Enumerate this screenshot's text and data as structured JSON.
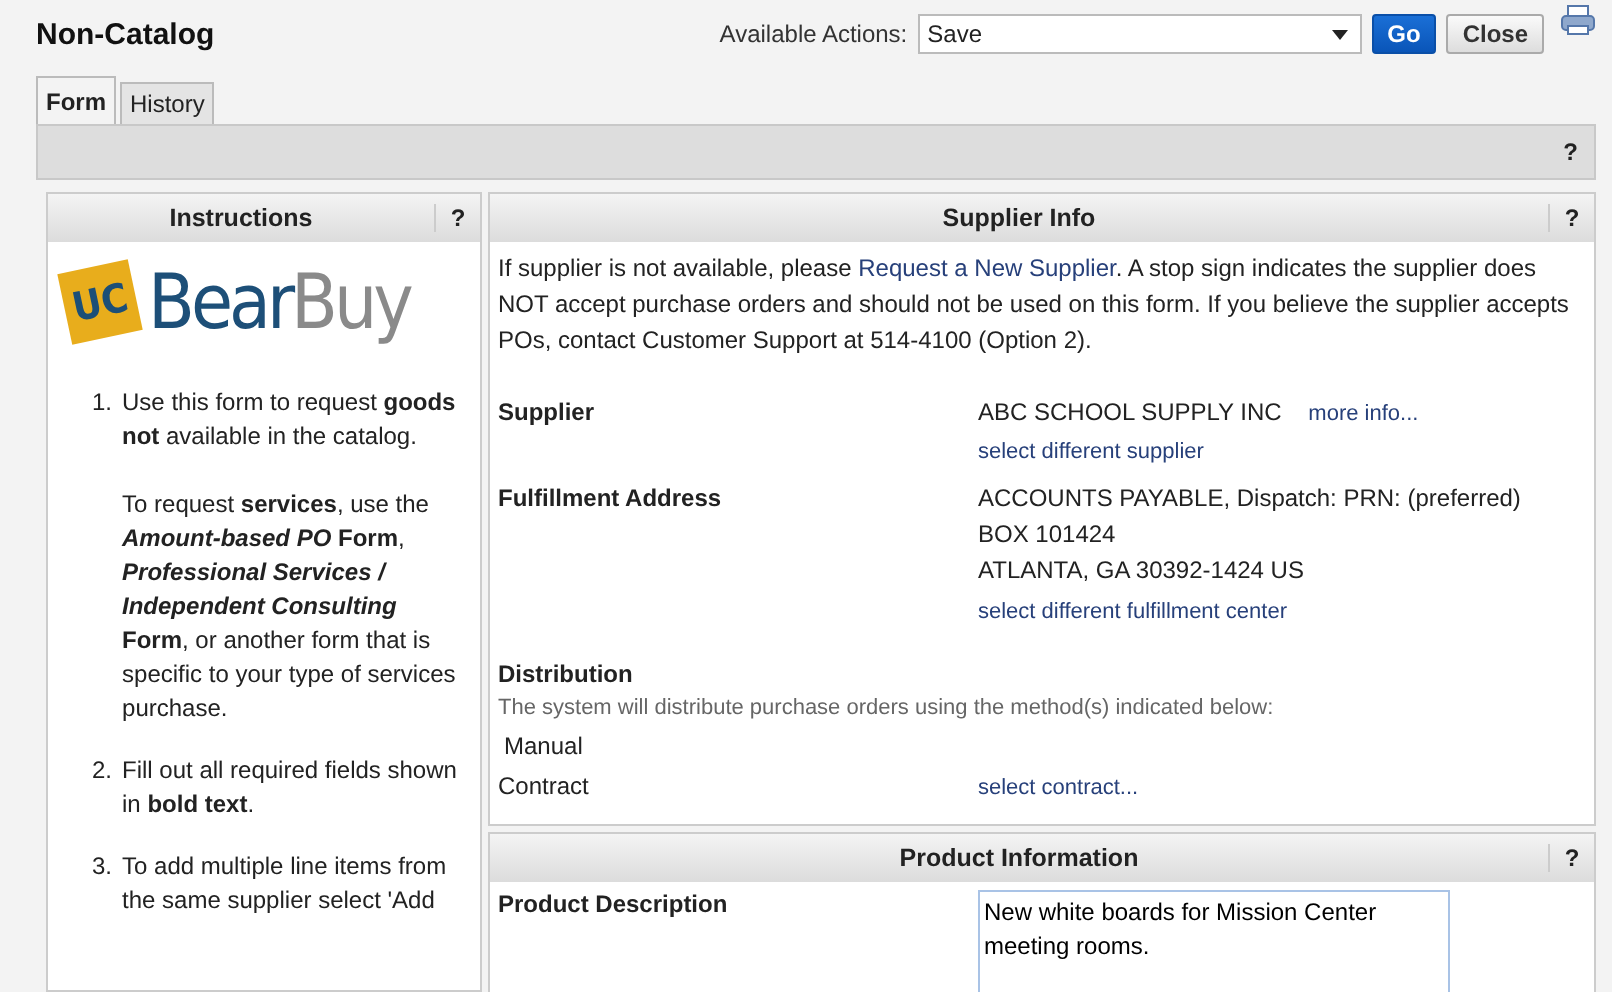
{
  "window": {
    "title": "Non-Catalog"
  },
  "actions": {
    "label": "Available Actions:",
    "value": "Save",
    "go": "Go",
    "close": "Close"
  },
  "tabs": [
    {
      "label": "Form",
      "selected": true
    },
    {
      "label": "History",
      "selected": false
    }
  ],
  "help_mark": "?",
  "instructions": {
    "title": "Instructions",
    "help": "?",
    "logo": {
      "badge": "UC",
      "name_first": "Bear",
      "name_second": "Buy"
    },
    "items": [
      {
        "number": "1.",
        "paragraphs": [
          "Use this form to request **goods not** available in the catalog.",
          "To request **services**, use the ***Amount-based PO* Form**, ***Professional Services / Independent Consulting* Form**, or another form that is specific to your type of services purchase."
        ]
      },
      {
        "number": "2.",
        "paragraphs": [
          "Fill out all required fields shown in **bold text**."
        ]
      },
      {
        "number": "3.",
        "paragraphs": [
          "To add multiple line items from the same supplier select 'Add"
        ]
      }
    ]
  },
  "supplier_info": {
    "title": "Supplier Info",
    "help": "?",
    "notice_before": "If supplier is not available, please ",
    "notice_link": "Request a New Supplier",
    "notice_after": ". A stop sign indicates the supplier does NOT accept purchase orders and should not be used on this form. If you believe the supplier accepts POs, contact Customer Support at 514-4100 (Option 2).",
    "supplier": {
      "label": "Supplier",
      "value": "ABC SCHOOL SUPPLY INC",
      "more": "more info...",
      "change": "select different supplier"
    },
    "fulfillment": {
      "label": "Fulfillment Address",
      "lines": [
        "ACCOUNTS PAYABLE, Dispatch: PRN: (preferred)",
        "BOX 101424",
        "ATLANTA, GA 30392-1424 US"
      ],
      "change": "select different fulfillment center"
    },
    "distribution": {
      "label": "Distribution",
      "note": "The system will distribute purchase orders using the method(s) indicated below:",
      "method": "Manual",
      "contract_label": "Contract",
      "contract_link": "select contract..."
    }
  },
  "product_info": {
    "title": "Product Information",
    "help": "?",
    "description_label": "Product Description",
    "description_value": "New white boards for Mission Center meeting rooms."
  }
}
